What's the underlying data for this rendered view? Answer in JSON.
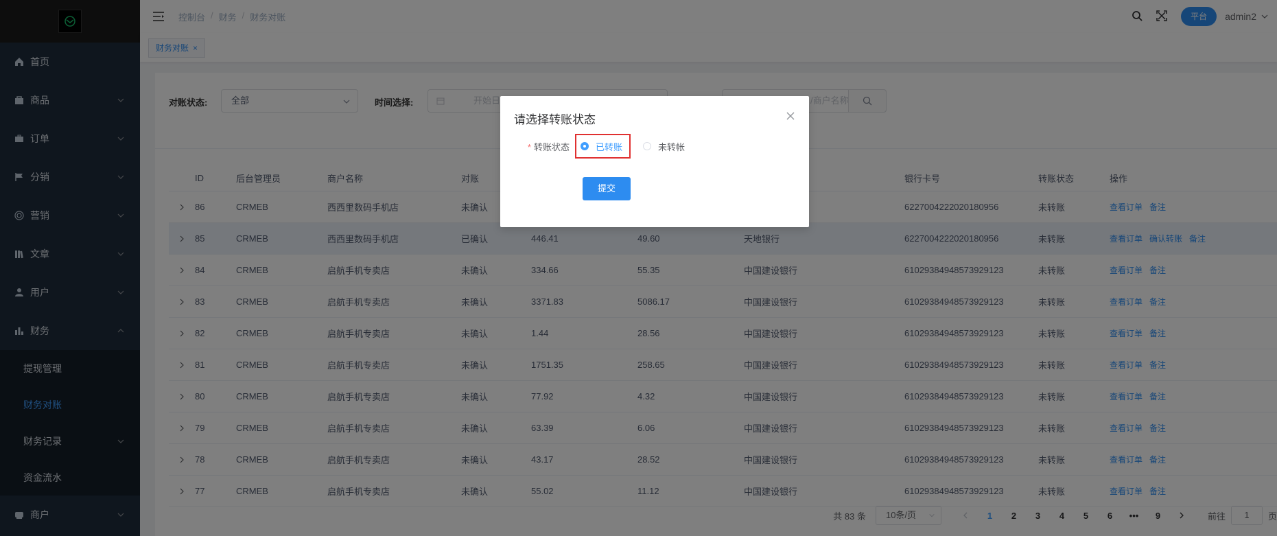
{
  "sidebar": {
    "items": [
      {
        "label": "首页",
        "icon": "home-icon"
      },
      {
        "label": "商品",
        "icon": "bag-icon"
      },
      {
        "label": "订单",
        "icon": "briefcase-icon"
      },
      {
        "label": "分销",
        "icon": "flag-icon"
      },
      {
        "label": "营销",
        "icon": "target-icon"
      },
      {
        "label": "文章",
        "icon": "book-icon"
      },
      {
        "label": "用户",
        "icon": "user-icon"
      },
      {
        "label": "财务",
        "icon": "bar-chart-icon"
      }
    ],
    "finance_sub": [
      {
        "label": "提现管理"
      },
      {
        "label": "财务对账"
      },
      {
        "label": "财务记录"
      },
      {
        "label": "资金流水"
      }
    ],
    "merchant": {
      "label": "商户",
      "icon": "store-icon"
    }
  },
  "header": {
    "breadcrumb": [
      "控制台",
      "财务",
      "财务对账"
    ],
    "breadcrumb_sep": "/",
    "platform": "平台",
    "username": "admin2"
  },
  "tags": {
    "active": "财务对账",
    "close": "×"
  },
  "filter": {
    "status_label": "对账状态:",
    "status_value": "全部",
    "time_label": "时间选择:",
    "date_placeholder": "开始日",
    "search_placeholder": "/商户名称"
  },
  "table": {
    "headers": [
      "ID",
      "后台管理员",
      "商户名称",
      "对账",
      "",
      "",
      "",
      "银行卡号",
      "转账状态",
      "操作"
    ],
    "rows": [
      {
        "id": "86",
        "admin": "CRMEB",
        "merchant": "西西里数码手机店",
        "status": "未确认",
        "amount": "",
        "fee": "",
        "bank": "",
        "card": "6227004222020180956",
        "transfer": "未转账"
      },
      {
        "id": "85",
        "admin": "CRMEB",
        "merchant": "西西里数码手机店",
        "status": "已确认",
        "amount": "446.41",
        "fee": "49.60",
        "bank": "天地银行",
        "card": "6227004222020180956",
        "transfer": "未转账"
      },
      {
        "id": "84",
        "admin": "CRMEB",
        "merchant": "启航手机专卖店",
        "status": "未确认",
        "amount": "334.66",
        "fee": "55.35",
        "bank": "中国建设银行",
        "card": "61029384948573929123",
        "transfer": "未转账"
      },
      {
        "id": "83",
        "admin": "CRMEB",
        "merchant": "启航手机专卖店",
        "status": "未确认",
        "amount": "3371.83",
        "fee": "5086.17",
        "bank": "中国建设银行",
        "card": "61029384948573929123",
        "transfer": "未转账"
      },
      {
        "id": "82",
        "admin": "CRMEB",
        "merchant": "启航手机专卖店",
        "status": "未确认",
        "amount": "1.44",
        "fee": "28.56",
        "bank": "中国建设银行",
        "card": "61029384948573929123",
        "transfer": "未转账"
      },
      {
        "id": "81",
        "admin": "CRMEB",
        "merchant": "启航手机专卖店",
        "status": "未确认",
        "amount": "1751.35",
        "fee": "258.65",
        "bank": "中国建设银行",
        "card": "61029384948573929123",
        "transfer": "未转账"
      },
      {
        "id": "80",
        "admin": "CRMEB",
        "merchant": "启航手机专卖店",
        "status": "未确认",
        "amount": "77.92",
        "fee": "4.32",
        "bank": "中国建设银行",
        "card": "61029384948573929123",
        "transfer": "未转账"
      },
      {
        "id": "79",
        "admin": "CRMEB",
        "merchant": "启航手机专卖店",
        "status": "未确认",
        "amount": "63.39",
        "fee": "6.06",
        "bank": "中国建设银行",
        "card": "61029384948573929123",
        "transfer": "未转账"
      },
      {
        "id": "78",
        "admin": "CRMEB",
        "merchant": "启航手机专卖店",
        "status": "未确认",
        "amount": "43.17",
        "fee": "28.52",
        "bank": "中国建设银行",
        "card": "61029384948573929123",
        "transfer": "未转账"
      },
      {
        "id": "77",
        "admin": "CRMEB",
        "merchant": "启航手机专卖店",
        "status": "未确认",
        "amount": "55.02",
        "fee": "11.12",
        "bank": "中国建设银行",
        "card": "61029384948573929123",
        "transfer": "未转账"
      }
    ],
    "op_view": "查看订单",
    "op_confirm": "确认转账",
    "op_note": "备注"
  },
  "pager": {
    "total": "共 83 条",
    "page_size": "10条/页",
    "pages": [
      "1",
      "2",
      "3",
      "4",
      "5",
      "6",
      "•••",
      "9"
    ],
    "goto_prefix": "前往",
    "goto_value": "1",
    "goto_suffix": "页"
  },
  "modal": {
    "title": "请选择转账状态",
    "required_mark": "*",
    "field_label": "转账状态",
    "option_done": "已转账",
    "option_not": "未转帐",
    "submit": "提交"
  },
  "colors": {
    "sidebar_bg": "#1f2d3d",
    "accent": "#2d8cf0",
    "highlight_border": "#e03030"
  }
}
